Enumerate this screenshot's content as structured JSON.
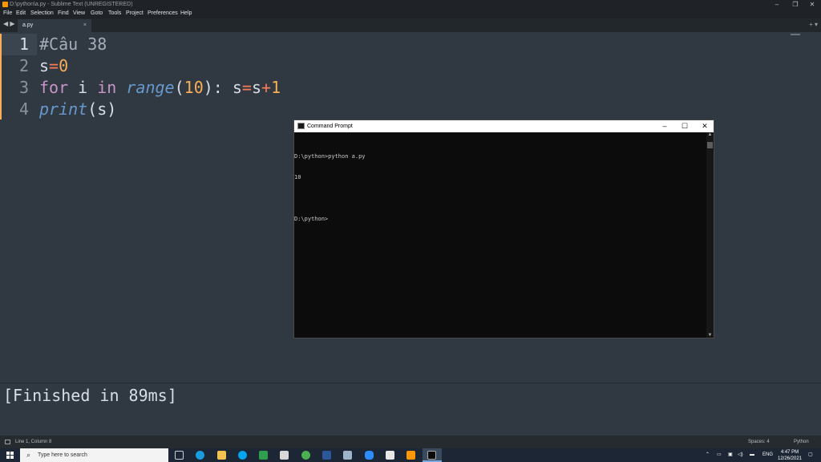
{
  "window": {
    "title": "D:\\python\\a.py - Sublime Text (UNREGISTERED)",
    "controls": {
      "minimize": "–",
      "restore": "❐",
      "close": "✕"
    }
  },
  "menu": [
    "File",
    "Edit",
    "Selection",
    "Find",
    "View",
    "Goto",
    "Tools",
    "Project",
    "Preferences",
    "Help"
  ],
  "tabs": {
    "nav": "◀ ▶",
    "active": {
      "label": "a.py",
      "close": "×"
    },
    "right_icons": "+ ▾"
  },
  "editor": {
    "lines": [
      {
        "num": "1",
        "tokens": [
          {
            "t": "#Câu 38",
            "c": "cm"
          }
        ]
      },
      {
        "num": "2",
        "tokens": [
          {
            "t": "s",
            "c": ""
          },
          {
            "t": "=",
            "c": "op"
          },
          {
            "t": "0",
            "c": "num"
          }
        ]
      },
      {
        "num": "3",
        "tokens": [
          {
            "t": "for",
            "c": "kw"
          },
          {
            "t": " i ",
            "c": ""
          },
          {
            "t": "in",
            "c": "kw"
          },
          {
            "t": " ",
            "c": ""
          },
          {
            "t": "range",
            "c": "fn"
          },
          {
            "t": "(",
            "c": ""
          },
          {
            "t": "10",
            "c": "num"
          },
          {
            "t": "): s",
            "c": ""
          },
          {
            "t": "=",
            "c": "op"
          },
          {
            "t": "s",
            "c": ""
          },
          {
            "t": "+",
            "c": "op"
          },
          {
            "t": "1",
            "c": "num"
          }
        ]
      },
      {
        "num": "4",
        "tokens": [
          {
            "t": "print",
            "c": "fn"
          },
          {
            "t": "(s)",
            "c": ""
          }
        ]
      }
    ]
  },
  "cmd": {
    "title": "Command Prompt",
    "lines": [
      "D:\\python>python a.py",
      "10",
      "",
      "D:\\python>"
    ],
    "controls": {
      "minimize": "–",
      "maximize": "☐",
      "close": "✕"
    }
  },
  "output": {
    "text": "[Finished in 89ms]"
  },
  "status": {
    "position": "Line 1, Column 8",
    "spaces": "Spaces: 4",
    "syntax": "Python"
  },
  "taskbar": {
    "search_placeholder": "Type here to search",
    "search_icon": "⌕",
    "tray_lang": "ENG",
    "time": "4:47 PM",
    "date": "12/26/2021"
  },
  "colors": {
    "accent": "#f9ae58",
    "editor_bg": "#303841",
    "taskbar_bg": "#1c2635"
  }
}
